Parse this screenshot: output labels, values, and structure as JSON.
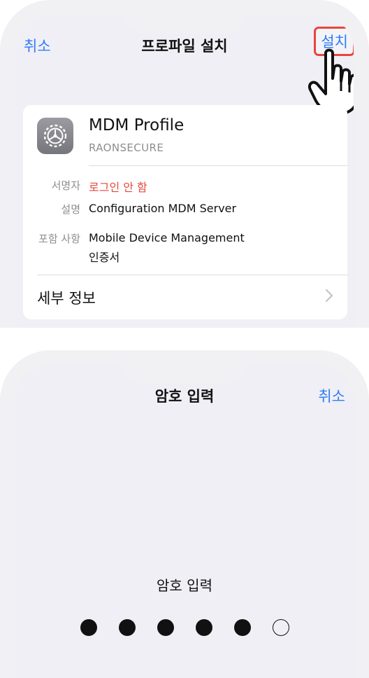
{
  "install_screen": {
    "nav": {
      "cancel_label": "취소",
      "title": "프로파일 설치",
      "install_label": "설치"
    },
    "profile": {
      "name": "MDM Profile",
      "organization": "RAONSECURE",
      "rows": [
        {
          "label": "서명자",
          "value": "로그인 안 함"
        },
        {
          "label": "설명",
          "value": "Configuration MDM Server"
        },
        {
          "label": "포함 사항",
          "value": "Mobile Device Management",
          "value2": "인증서"
        }
      ],
      "details_label": "세부 정보"
    },
    "colors": {
      "accent": "#2f7df6",
      "warning": "#e5483c",
      "highlight_border": "#e5483c"
    }
  },
  "password_screen": {
    "nav": {
      "title": "암호 입력",
      "cancel_label": "취소"
    },
    "prompt": "암호 입력",
    "passcode": {
      "entered": 5,
      "total": 6
    }
  }
}
